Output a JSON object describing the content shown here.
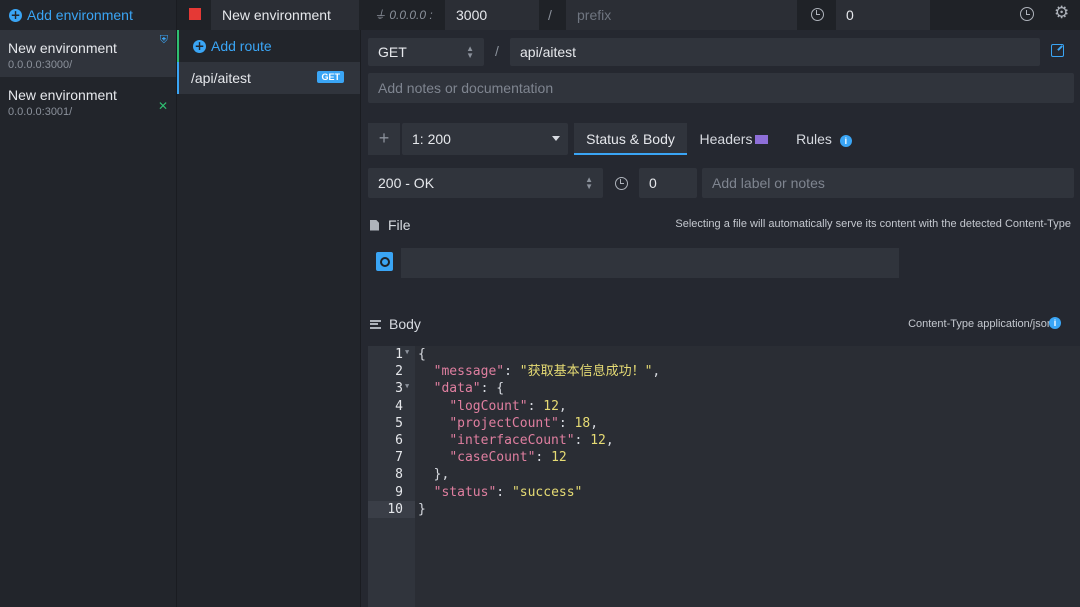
{
  "sidebar": {
    "add_environment": "Add environment",
    "environments": [
      {
        "name": "New environment",
        "address": "0.0.0.0:3000/",
        "active": true
      },
      {
        "name": "New environment",
        "address": "0.0.0.0:3001/",
        "active": false
      }
    ]
  },
  "topbar": {
    "env_name": "New environment",
    "host": "0.0.0.0 :",
    "port": "3000",
    "slash": "/",
    "prefix_placeholder": "prefix",
    "latency": "0"
  },
  "routes": {
    "add_route": "Add route",
    "items": [
      {
        "path": "/api/aitest",
        "method": "GET"
      }
    ]
  },
  "route_editor": {
    "method": "GET",
    "slash": "/",
    "path": "api/aitest",
    "notes_placeholder": "Add notes or documentation",
    "add_response": "+",
    "response_selected": "1: 200",
    "tabs": [
      "Status & Body",
      "Headers",
      "Rules"
    ],
    "status": "200 - OK",
    "response_latency": "0",
    "label_placeholder": "Add label or notes",
    "file_label": "File",
    "file_hint": "Selecting a file will automatically serve its content with the detected Content-Type",
    "body_label": "Body",
    "content_type": "Content-Type application/json",
    "colors": {
      "accent": "#3aa5f5",
      "active_green": "#2fbf71",
      "stop": "#e53935"
    }
  },
  "body_code": {
    "line_numbers": [
      "1",
      "2",
      "3",
      "4",
      "5",
      "6",
      "7",
      "8",
      "9",
      "10"
    ],
    "lines": [
      {
        "indent": "",
        "key": "",
        "value": "",
        "text": "{"
      },
      {
        "indent": "  ",
        "key": "\"message\"",
        "value": "\"获取基本信息成功！\"",
        "text": ","
      },
      {
        "indent": "  ",
        "key": "\"data\"",
        "value": "",
        "text": ": {"
      },
      {
        "indent": "    ",
        "key": "\"logCount\"",
        "value": "12",
        "text": ","
      },
      {
        "indent": "    ",
        "key": "\"projectCount\"",
        "value": "18",
        "text": ","
      },
      {
        "indent": "    ",
        "key": "\"interfaceCount\"",
        "value": "12",
        "text": ","
      },
      {
        "indent": "    ",
        "key": "\"caseCount\"",
        "value": "12",
        "text": ""
      },
      {
        "indent": "  ",
        "key": "",
        "value": "",
        "text": "},"
      },
      {
        "indent": "  ",
        "key": "\"status\"",
        "value": "\"success\"",
        "text": ""
      },
      {
        "indent": "",
        "key": "",
        "value": "",
        "text": "}"
      }
    ]
  }
}
